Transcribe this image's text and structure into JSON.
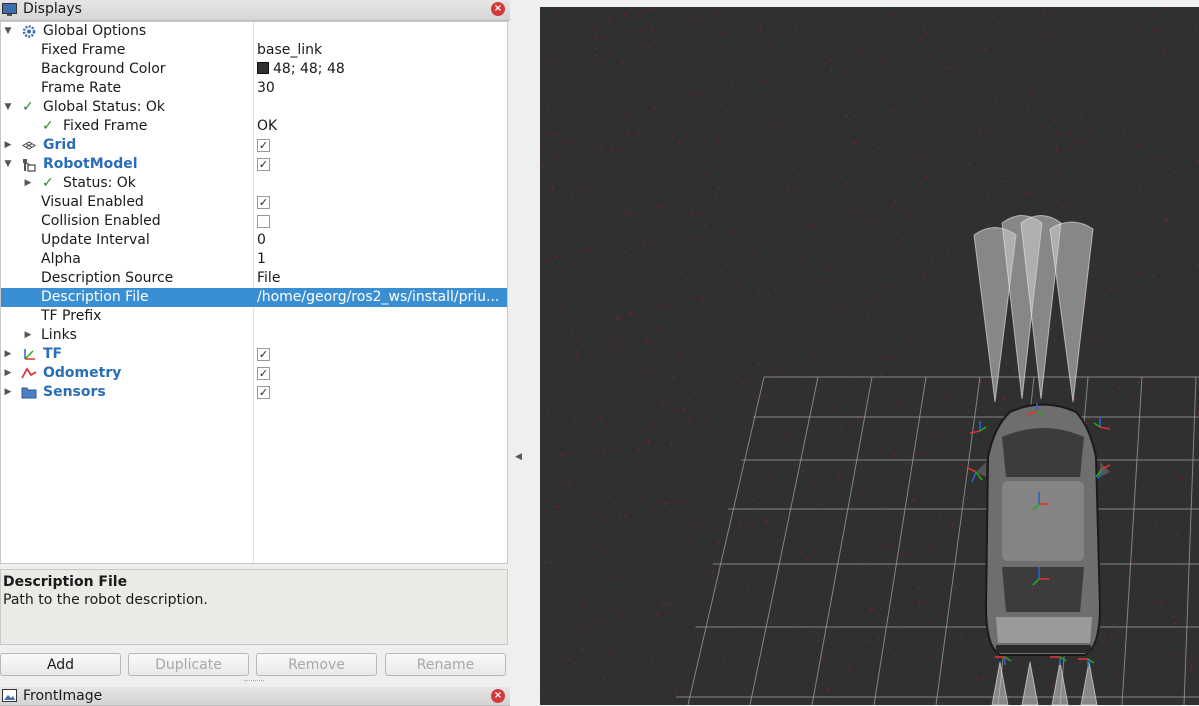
{
  "displays_panel": {
    "title": "Displays",
    "close_glyph": "×",
    "rows": [
      {
        "label": "Global Options",
        "value": ""
      },
      {
        "label": "Fixed Frame",
        "value": "base_link"
      },
      {
        "label": "Background Color",
        "value": "48; 48; 48"
      },
      {
        "label": "Frame Rate",
        "value": "30"
      },
      {
        "label": "Global Status: Ok",
        "value": ""
      },
      {
        "label": "Fixed Frame",
        "value": "OK"
      },
      {
        "label": "Grid",
        "value": ""
      },
      {
        "label": "RobotModel",
        "value": ""
      },
      {
        "label": "Status: Ok",
        "value": ""
      },
      {
        "label": "Visual Enabled",
        "value": ""
      },
      {
        "label": "Collision Enabled",
        "value": ""
      },
      {
        "label": "Update Interval",
        "value": "0"
      },
      {
        "label": "Alpha",
        "value": "1"
      },
      {
        "label": "Description Source",
        "value": "File"
      },
      {
        "label": "Description File",
        "value": "/home/georg/ros2_ws/install/priu..."
      },
      {
        "label": "TF Prefix",
        "value": ""
      },
      {
        "label": "Links",
        "value": ""
      },
      {
        "label": "TF",
        "value": ""
      },
      {
        "label": "Odometry",
        "value": ""
      },
      {
        "label": "Sensors",
        "value": ""
      }
    ],
    "checkboxes": {
      "grid": true,
      "robotmodel": true,
      "visual_enabled": true,
      "collision_enabled": false,
      "tf": true,
      "odometry": true,
      "sensors": true
    },
    "check_glyph": "✓",
    "background_color_hex": "#303030"
  },
  "description": {
    "title": "Description File",
    "text": "Path to the robot description."
  },
  "buttons": {
    "add": "Add",
    "duplicate": "Duplicate",
    "remove": "Remove",
    "rename": "Rename"
  },
  "bottom_panel": {
    "title": "FrontImage"
  },
  "colors": {
    "selection": "#3a8fd2",
    "accent_blue": "#2a6db8",
    "viewport_bg": "#303030",
    "grid": "#a0a0a0",
    "point_cloud": "#b02020"
  }
}
